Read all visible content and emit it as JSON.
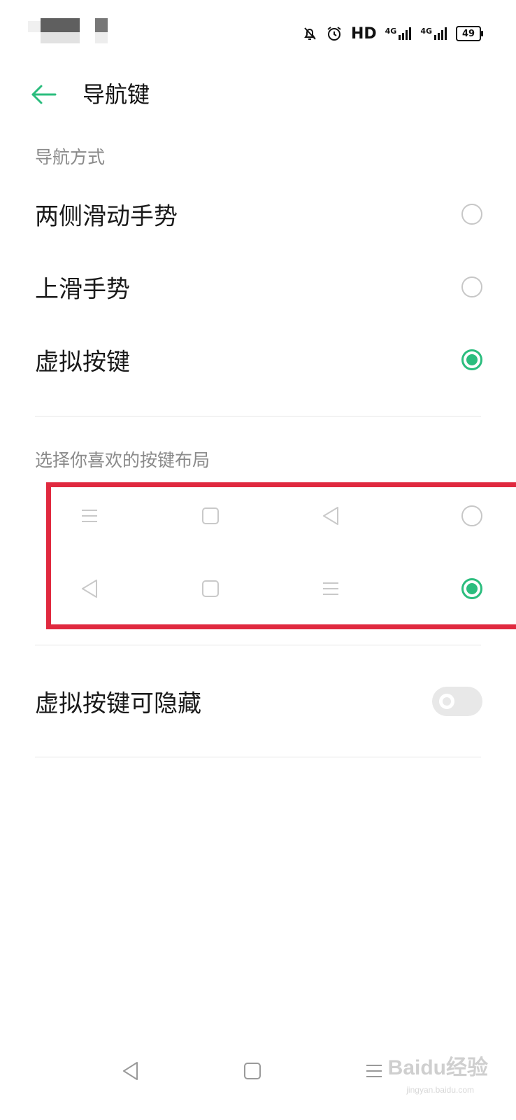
{
  "status_bar": {
    "hd_label": "HD",
    "network_1": "4G",
    "network_2": "4G",
    "battery": "49"
  },
  "header": {
    "title": "导航键"
  },
  "nav_mode": {
    "section_title": "导航方式",
    "options": [
      {
        "label": "两侧滑动手势",
        "selected": false
      },
      {
        "label": "上滑手势",
        "selected": false
      },
      {
        "label": "虚拟按键",
        "selected": true
      }
    ]
  },
  "layout": {
    "section_title": "选择你喜欢的按键布局",
    "rows": [
      {
        "icons": [
          "menu-icon",
          "square-icon",
          "back-triangle-icon"
        ],
        "selected": false
      },
      {
        "icons": [
          "back-triangle-icon",
          "square-icon",
          "menu-icon"
        ],
        "selected": true
      }
    ]
  },
  "hideable": {
    "label": "虚拟按键可隐藏",
    "enabled": false
  },
  "bottom_nav": {
    "icons": [
      "back-triangle-icon",
      "home-square-icon",
      "menu-icon"
    ]
  },
  "watermark": {
    "brand": "Baidu经验",
    "site": "jingyan.baidu.com"
  },
  "colors": {
    "accent": "#2bbd7e",
    "highlight": "#e0293f",
    "text_primary": "#1a1a1a",
    "text_secondary": "#8a8a8a"
  }
}
